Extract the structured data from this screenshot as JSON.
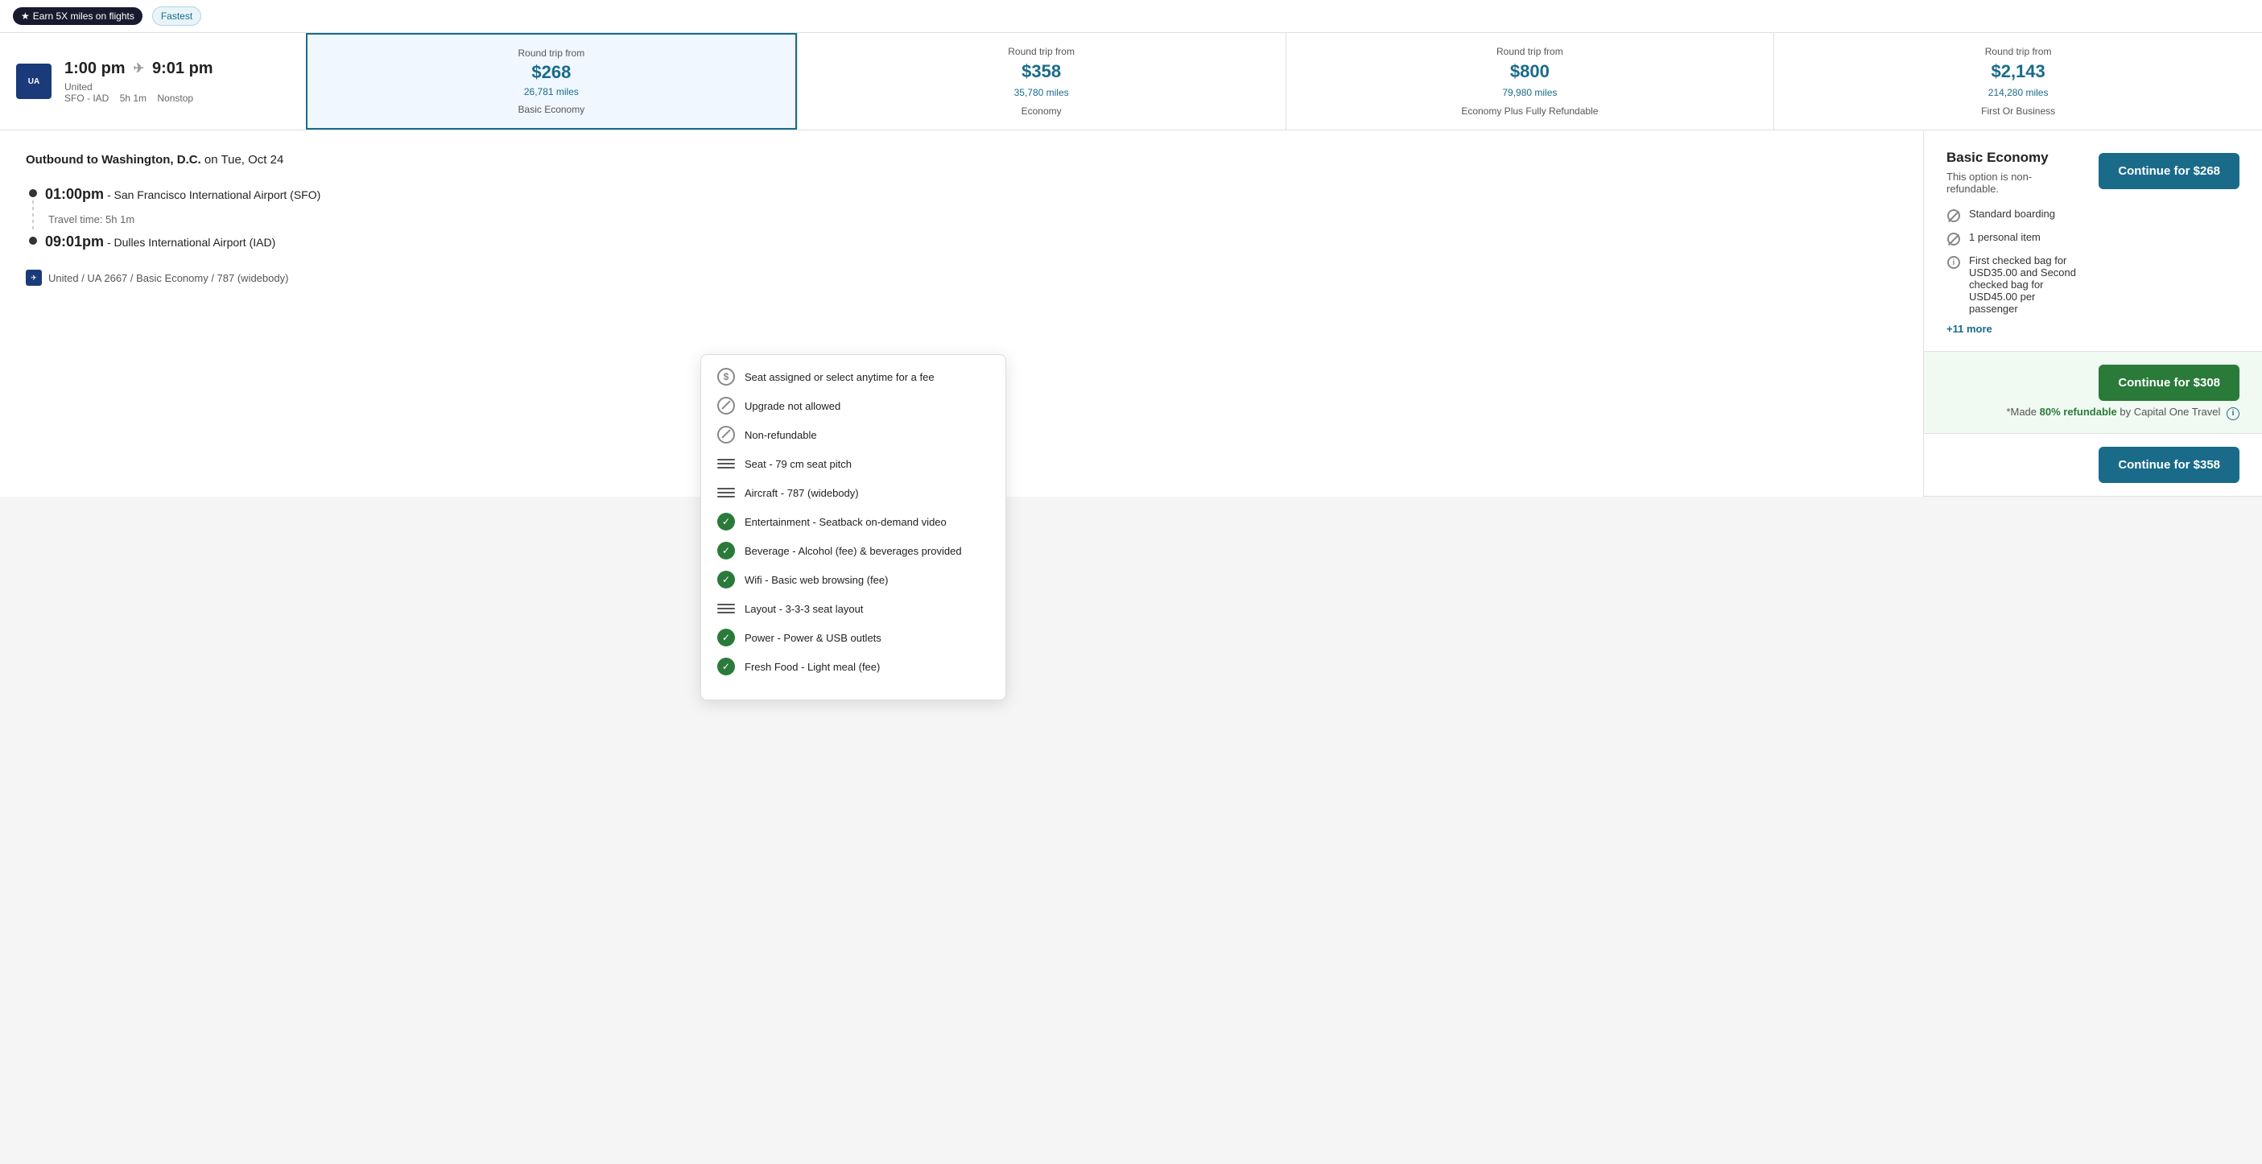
{
  "topBar": {
    "earnBadge": "Earn 5X miles on flights",
    "fastestBadge": "Fastest"
  },
  "flightCard": {
    "departTime": "1:00 pm",
    "arriveTime": "9:01 pm",
    "airline": "United",
    "route": "SFO - IAD",
    "duration": "5h 1m",
    "stops": "Nonstop",
    "logoText": "UA"
  },
  "priceCards": [
    {
      "label": "Round trip from",
      "amount": "$268",
      "miles": "26,781 miles",
      "type": "Basic Economy",
      "selected": true
    },
    {
      "label": "Round trip from",
      "amount": "$358",
      "miles": "35,780 miles",
      "type": "Economy",
      "selected": false
    },
    {
      "label": "Round trip from",
      "amount": "$800",
      "miles": "79,980 miles",
      "type": "Economy Plus Fully Refundable",
      "selected": false
    },
    {
      "label": "Round trip from",
      "amount": "$2,143",
      "miles": "214,280 miles",
      "type": "First Or Business",
      "selected": false
    }
  ],
  "leftPanel": {
    "outboundLabel": "Outbound to",
    "destination": "Washington, D.C.",
    "date": "on Tue, Oct 24",
    "departFull": "01:00pm",
    "departAirport": "San Francisco International Airport (SFO)",
    "travelTime": "Travel time: 5h 1m",
    "arriveFull": "09:01pm",
    "arriveAirport": "Dulles International Airport (IAD)",
    "flightDetails": "United / UA 2667 / Basic Economy / 787 (widebody)"
  },
  "farePanel": {
    "title": "Basic Economy",
    "subtitle": "This option is non-refundable.",
    "features": [
      {
        "icon": "circle-slash",
        "text": "Standard boarding"
      },
      {
        "icon": "circle-slash",
        "text": "1 personal item"
      },
      {
        "icon": "info",
        "text": "First checked bag for USD35.00 and Second checked bag for USD45.00 per passenger"
      }
    ],
    "moreText": "+11 more",
    "continueLabel": "Continue for $268"
  },
  "economySection": {
    "continueLabel": "Continue for $308",
    "refundableText": "*Made",
    "refundableHighlight": "80% refundable",
    "refundableBy": "by Capital One Travel"
  },
  "economySection2": {
    "continueLabel": "Continue for $358"
  },
  "popup": {
    "features": [
      {
        "icon": "dollar-circle",
        "text": "Seat assigned or select anytime for a fee"
      },
      {
        "icon": "circle-ban",
        "text": "Upgrade not allowed"
      },
      {
        "icon": "circle-ban",
        "text": "Non-refundable"
      },
      {
        "icon": "lines",
        "text": "Seat - 79 cm seat pitch"
      },
      {
        "icon": "lines",
        "text": "Aircraft - 787 (widebody)"
      },
      {
        "icon": "green-check",
        "text": "Entertainment - Seatback on-demand video"
      },
      {
        "icon": "green-check",
        "text": "Beverage - Alcohol (fee) & beverages provided"
      },
      {
        "icon": "green-check",
        "text": "Wifi - Basic web browsing (fee)"
      },
      {
        "icon": "lines",
        "text": "Layout - 3-3-3 seat layout"
      },
      {
        "icon": "green-check",
        "text": "Power - Power & USB outlets"
      },
      {
        "icon": "green-check",
        "text": "Fresh Food - Light meal (fee)"
      }
    ]
  }
}
